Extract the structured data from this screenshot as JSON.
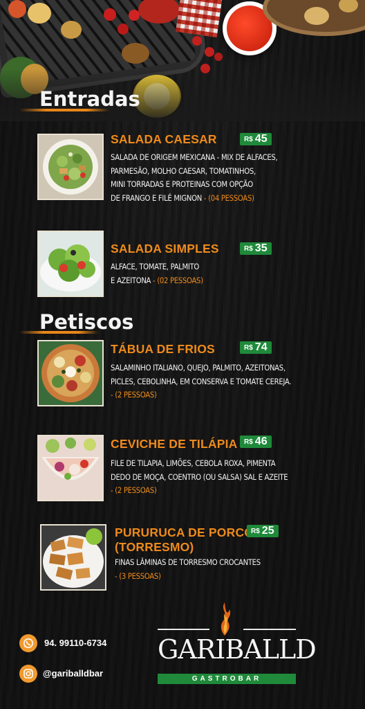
{
  "sections": [
    {
      "title": "Entradas"
    },
    {
      "title": "Petiscos"
    }
  ],
  "items": [
    {
      "name": "SALADA CAESAR",
      "currency": "R$",
      "price": "45",
      "desc_lines": [
        "SALADA DE ORIGEM MEXICANA - MIX DE ALFACES,",
        "PARMESÃO, MOLHO CAESAR, TOMATINHOS,",
        "MINI TORRADAS E PROTEINAS COM OPÇÃO",
        "DE FRANGO E FILÉ MIGNON"
      ],
      "serving": "- (04 PESSOAS)"
    },
    {
      "name": "SALADA SIMPLES",
      "currency": "R$",
      "price": "35",
      "desc_lines": [
        "ALFACE, TOMATE, PALMITO",
        "E AZEITONA"
      ],
      "serving": "- (02 PESSOAS)"
    },
    {
      "name": "TÁBUA DE FRIOS",
      "currency": "R$",
      "price": "74",
      "desc_lines": [
        "SALAMINHO ITALIANO, QUEJO, PALMITO, AZEITONAS,",
        "PICLES, CEBOLINHA, EM CONSERVA E TOMATE CEREJA."
      ],
      "serving": "- (2 PESSOAS)"
    },
    {
      "name": "CEVICHE DE TILÁPIA",
      "currency": "R$",
      "price": "46",
      "desc_lines": [
        "FILE DE TILAPIA, LIMÕES, CEBOLA ROXA, PIMENTA",
        "DEDO DE MOÇA, COENTRO (OU SALSA) SAL E AZEITE"
      ],
      "serving": "- (2 PESSOAS)"
    },
    {
      "name_lines": [
        "PURURUCA DE PORCO",
        "(TORRESMO)"
      ],
      "currency": "R$",
      "price": "25",
      "desc_lines": [
        "FINAS LÂMINAS DE TORRESMO CROCANTES"
      ],
      "serving": "- (3 PESSOAS)"
    }
  ],
  "contact": {
    "phone": "94. 99110-6734",
    "instagram": "@gariballdbar",
    "phone_icon": "whatsapp-icon",
    "instagram_icon": "instagram-icon"
  },
  "brand": {
    "name": "GARIBALLD",
    "tagline": "GASTROBAR"
  },
  "colors": {
    "accent_orange": "#ee8a1c",
    "price_green": "#1f8a3a",
    "background": "#1a1a1a"
  }
}
